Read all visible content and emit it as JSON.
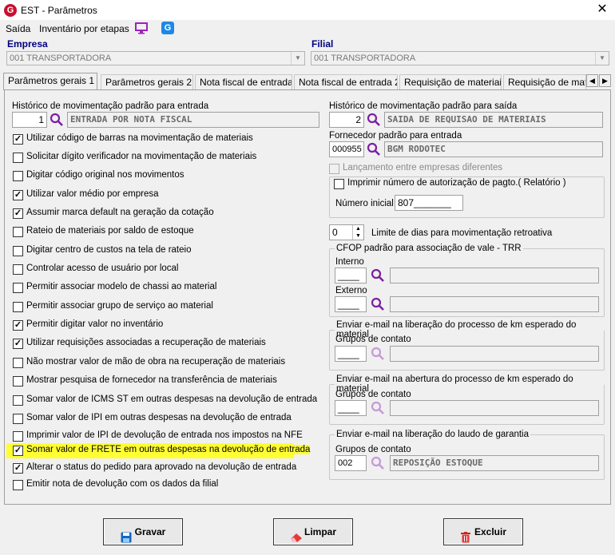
{
  "window": {
    "title": "EST - Parâmetros",
    "close": "✕",
    "app_icon": "G"
  },
  "menu": {
    "saida": "Saída",
    "inventario": "Inventário por etapas"
  },
  "empresa": {
    "label": "Empresa",
    "value": "001 TRANSPORTADORA"
  },
  "filial": {
    "label": "Filial",
    "value": "001 TRANSPORTADORA"
  },
  "tabs": [
    "Parâmetros gerais 1",
    "Parâmetros gerais 2",
    "Nota fiscal de entrada",
    "Nota fiscal de entrada 2",
    "Requisição de materiais",
    "Requisição de materi"
  ],
  "left": {
    "hist_entrada_label": "Histórico de movimentação padrão para entrada",
    "hist_entrada_code": "1",
    "hist_entrada_desc": "ENTRADA POR NOTA FISCAL",
    "checks": [
      {
        "label": "Utilizar código de barras na movimentação de materiais",
        "checked": "✓"
      },
      {
        "label": "Solicitar dígito verificador na movimentação de materiais",
        "checked": ""
      },
      {
        "label": "Digitar código original nos movimentos",
        "checked": ""
      },
      {
        "label": "Utilizar valor médio por empresa",
        "checked": "✓"
      },
      {
        "label": "Assumir marca default na geração da cotação",
        "checked": "✓"
      },
      {
        "label": "Rateio de materiais por saldo de estoque",
        "checked": ""
      },
      {
        "label": "Digitar centro de custos na tela de rateio",
        "checked": ""
      },
      {
        "label": "Controlar acesso de usuário por local",
        "checked": ""
      },
      {
        "label": "Permitir associar modelo de chassi ao material",
        "checked": ""
      },
      {
        "label": "Permitir associar grupo de serviço ao material",
        "checked": ""
      },
      {
        "label": "Permitir digitar valor no inventário",
        "checked": "✓"
      },
      {
        "label": "Utilizar requisições associadas a recuperação de materiais",
        "checked": "✓"
      },
      {
        "label": "Não mostrar valor de mão de obra na recuperação de materiais",
        "checked": ""
      },
      {
        "label": "Mostrar pesquisa de fornecedor na transferência de materiais",
        "checked": ""
      },
      {
        "label": "Somar valor de ICMS ST em outras despesas na devolução de entrada",
        "checked": ""
      },
      {
        "label": "Somar valor de IPI em outras despesas na devolução de entrada",
        "checked": ""
      },
      {
        "label": "Imprimir valor de IPI de devolução de entrada nos impostos na NFE",
        "checked": ""
      },
      {
        "label": "Somar valor de FRETE em outras despesas na devolução de entrada",
        "checked": "✓"
      },
      {
        "label": "Alterar o status do pedido para aprovado na devolução de entrada",
        "checked": "✓"
      },
      {
        "label": "Emitir nota de devolução com os dados da filial",
        "checked": ""
      }
    ]
  },
  "right": {
    "hist_saida_label": "Histórico de movimentação padrão para saída",
    "hist_saida_code": "2",
    "hist_saida_desc": "SAIDA DE REQUISAO DE MATERIAIS",
    "fornecedor_label": "Fornecedor padrão para entrada",
    "fornecedor_code": "000955",
    "fornecedor_desc": "BGM RODOTEC",
    "lanc_label": "Lançamento entre empresas diferentes",
    "imprimir_label": "Imprimir número de autorização de pagto.( Relatório )",
    "numero_inicial_label": "Número inicial",
    "numero_inicial_value": "807_______",
    "limite_value": "0",
    "limite_label": "Limite de dias para movimentação retroativa",
    "cfop_legend": "CFOP padrão para associação de vale - TRR",
    "interno_label": "Interno",
    "interno_value": "____",
    "externo_label": "Externo",
    "externo_value": "____",
    "email1_legend": "Enviar e-mail na liberação do processo de km esperado do material",
    "email1_grupos": "Grupos de contato",
    "email1_value": "____",
    "email2_legend": "Enviar e-mail na abertura do processo de km esperado do material",
    "email2_grupos": "Grupos de contato",
    "email2_value": "____",
    "email3_legend": "Enviar e-mail na liberação do laudo de garantia",
    "email3_grupos": "Grupos de contato",
    "email3_code": "002",
    "email3_desc": "REPOSIÇÃO ESTOQUE"
  },
  "buttons": {
    "gravar": "Gravar",
    "limpar": "Limpar",
    "excluir": "Excluir"
  }
}
